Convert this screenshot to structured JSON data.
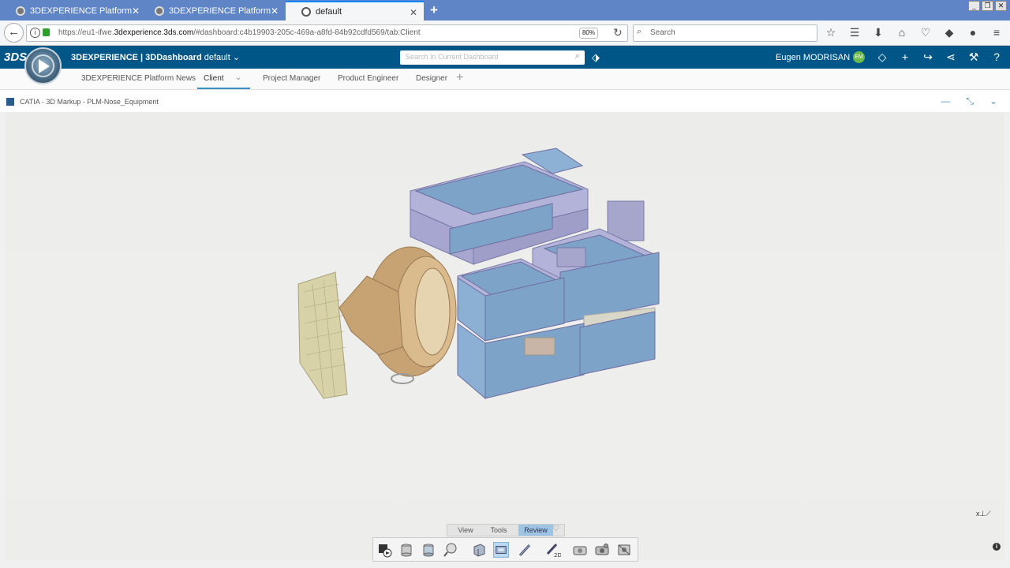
{
  "browser": {
    "tabs": [
      {
        "label": "3DEXPERIENCE Platform",
        "close": "✕"
      },
      {
        "label": "3DEXPERIENCE Platform",
        "close": "✕"
      },
      {
        "label": "default",
        "close": "✕"
      }
    ],
    "new_tab": "+",
    "url_prefix": "https://eu1-ifwe.",
    "url_domain": "3dexperience.3ds.com",
    "url_suffix": "/#dashboard:c4b19903-205c-469a-a8fd-84b92cdfd569/tab:Client",
    "zoom": "80%",
    "search_placeholder": "Search"
  },
  "app": {
    "brand_bold": "3D",
    "brand_rest": "EXPERIENCE | 3DDashboard",
    "dashboard_name": "default",
    "search_placeholder": "Search In Current Dashboard",
    "user_name": "Eugen MODRISAN",
    "user_initials": "EM"
  },
  "dashboard_tabs": [
    {
      "label": "3DEXPERIENCE Platform News"
    },
    {
      "label": "Client"
    },
    {
      "label": "Project Manager"
    },
    {
      "label": "Product Engineer"
    },
    {
      "label": "Designer"
    }
  ],
  "widget": {
    "title": "CATIA - 3D Markup - PLM-Nose_Equipment"
  },
  "toolbar": {
    "tabs": [
      "View",
      "Tools",
      "Review"
    ],
    "active_tab": "Review",
    "tools": [
      "snapshot-icon",
      "section-icon",
      "compare-icon",
      "measure-icon",
      "cube-icon",
      "3d-markup-icon",
      "3d-pencil-icon",
      "2d-pencil-icon",
      "camera-icon",
      "camera-settings-icon",
      "capture-icon"
    ]
  },
  "compass_axis": "x",
  "colors": {
    "header_blue": "#005686",
    "tab_bar": "#5f85c7",
    "part_blue": "#7ea3c9",
    "frame_lavender": "#b3b3d9",
    "gold": "#c7a273"
  }
}
